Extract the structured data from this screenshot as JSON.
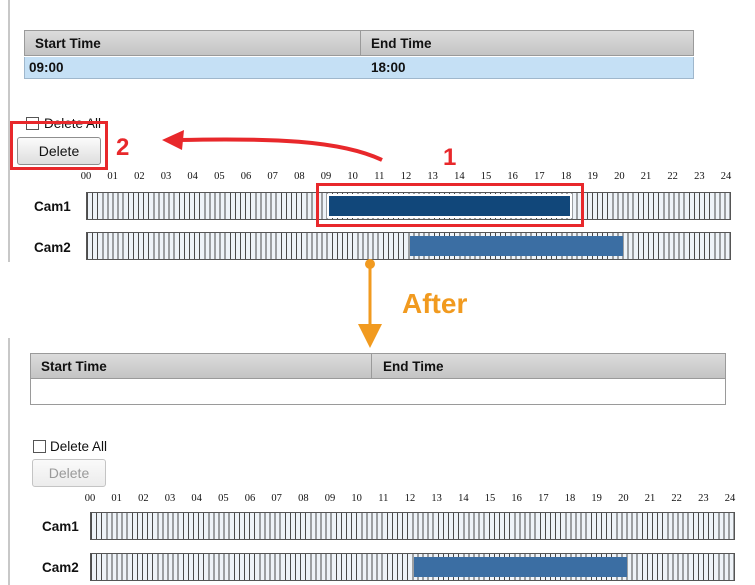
{
  "before": {
    "table": {
      "headers": [
        "Start Time",
        "End Time"
      ],
      "rows": [
        [
          "09:00",
          "18:00"
        ]
      ]
    },
    "delete_all_label": "Delete All",
    "delete_label": "Delete",
    "hours": [
      "00",
      "01",
      "02",
      "03",
      "04",
      "05",
      "06",
      "07",
      "08",
      "09",
      "10",
      "11",
      "12",
      "13",
      "14",
      "15",
      "16",
      "17",
      "18",
      "19",
      "20",
      "21",
      "22",
      "23",
      "24"
    ],
    "cameras": [
      {
        "name": "Cam1",
        "schedule_hours": [
          9,
          18
        ],
        "selected": true
      },
      {
        "name": "Cam2",
        "schedule_hours": [
          12,
          20
        ],
        "selected": false
      }
    ]
  },
  "annotations": {
    "step1": "1",
    "step2": "2",
    "after_label": "After",
    "accent_red": "#e8282b",
    "accent_orange": "#f19a1f"
  },
  "after": {
    "table": {
      "headers": [
        "Start Time",
        "End Time"
      ],
      "rows": []
    },
    "delete_all_label": "Delete All",
    "delete_label": "Delete",
    "hours": [
      "00",
      "01",
      "02",
      "03",
      "04",
      "05",
      "06",
      "07",
      "08",
      "09",
      "10",
      "11",
      "12",
      "13",
      "14",
      "15",
      "16",
      "17",
      "18",
      "19",
      "20",
      "21",
      "22",
      "23",
      "24"
    ],
    "cameras": [
      {
        "name": "Cam1",
        "schedule_hours": null,
        "selected": false
      },
      {
        "name": "Cam2",
        "schedule_hours": [
          12,
          20
        ],
        "selected": false
      }
    ]
  },
  "colors": {
    "selected_row_bg": "#c5e0f5",
    "schedule_fill": "#3b6ea3",
    "schedule_selected_fill": "#11477a"
  }
}
